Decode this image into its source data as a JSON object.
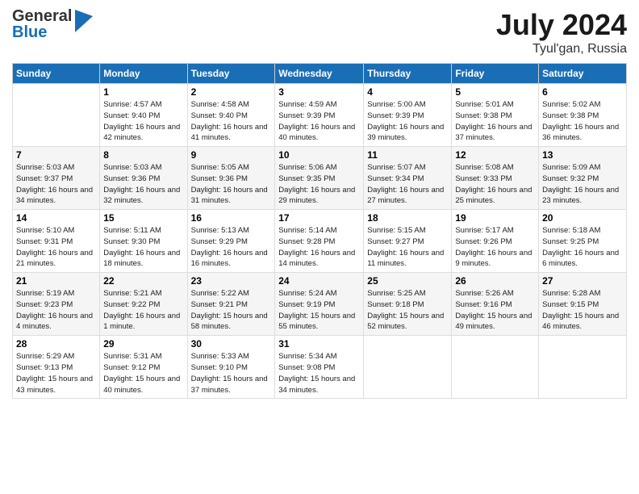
{
  "header": {
    "logo_general": "General",
    "logo_blue": "Blue",
    "month": "July 2024",
    "location": "Tyul'gan, Russia"
  },
  "days_of_week": [
    "Sunday",
    "Monday",
    "Tuesday",
    "Wednesday",
    "Thursday",
    "Friday",
    "Saturday"
  ],
  "weeks": [
    [
      {
        "day": "",
        "sunrise": "",
        "sunset": "",
        "daylight": ""
      },
      {
        "day": "1",
        "sunrise": "Sunrise: 4:57 AM",
        "sunset": "Sunset: 9:40 PM",
        "daylight": "Daylight: 16 hours and 42 minutes."
      },
      {
        "day": "2",
        "sunrise": "Sunrise: 4:58 AM",
        "sunset": "Sunset: 9:40 PM",
        "daylight": "Daylight: 16 hours and 41 minutes."
      },
      {
        "day": "3",
        "sunrise": "Sunrise: 4:59 AM",
        "sunset": "Sunset: 9:39 PM",
        "daylight": "Daylight: 16 hours and 40 minutes."
      },
      {
        "day": "4",
        "sunrise": "Sunrise: 5:00 AM",
        "sunset": "Sunset: 9:39 PM",
        "daylight": "Daylight: 16 hours and 39 minutes."
      },
      {
        "day": "5",
        "sunrise": "Sunrise: 5:01 AM",
        "sunset": "Sunset: 9:38 PM",
        "daylight": "Daylight: 16 hours and 37 minutes."
      },
      {
        "day": "6",
        "sunrise": "Sunrise: 5:02 AM",
        "sunset": "Sunset: 9:38 PM",
        "daylight": "Daylight: 16 hours and 36 minutes."
      }
    ],
    [
      {
        "day": "7",
        "sunrise": "Sunrise: 5:03 AM",
        "sunset": "Sunset: 9:37 PM",
        "daylight": "Daylight: 16 hours and 34 minutes."
      },
      {
        "day": "8",
        "sunrise": "Sunrise: 5:03 AM",
        "sunset": "Sunset: 9:36 PM",
        "daylight": "Daylight: 16 hours and 32 minutes."
      },
      {
        "day": "9",
        "sunrise": "Sunrise: 5:05 AM",
        "sunset": "Sunset: 9:36 PM",
        "daylight": "Daylight: 16 hours and 31 minutes."
      },
      {
        "day": "10",
        "sunrise": "Sunrise: 5:06 AM",
        "sunset": "Sunset: 9:35 PM",
        "daylight": "Daylight: 16 hours and 29 minutes."
      },
      {
        "day": "11",
        "sunrise": "Sunrise: 5:07 AM",
        "sunset": "Sunset: 9:34 PM",
        "daylight": "Daylight: 16 hours and 27 minutes."
      },
      {
        "day": "12",
        "sunrise": "Sunrise: 5:08 AM",
        "sunset": "Sunset: 9:33 PM",
        "daylight": "Daylight: 16 hours and 25 minutes."
      },
      {
        "day": "13",
        "sunrise": "Sunrise: 5:09 AM",
        "sunset": "Sunset: 9:32 PM",
        "daylight": "Daylight: 16 hours and 23 minutes."
      }
    ],
    [
      {
        "day": "14",
        "sunrise": "Sunrise: 5:10 AM",
        "sunset": "Sunset: 9:31 PM",
        "daylight": "Daylight: 16 hours and 21 minutes."
      },
      {
        "day": "15",
        "sunrise": "Sunrise: 5:11 AM",
        "sunset": "Sunset: 9:30 PM",
        "daylight": "Daylight: 16 hours and 18 minutes."
      },
      {
        "day": "16",
        "sunrise": "Sunrise: 5:13 AM",
        "sunset": "Sunset: 9:29 PM",
        "daylight": "Daylight: 16 hours and 16 minutes."
      },
      {
        "day": "17",
        "sunrise": "Sunrise: 5:14 AM",
        "sunset": "Sunset: 9:28 PM",
        "daylight": "Daylight: 16 hours and 14 minutes."
      },
      {
        "day": "18",
        "sunrise": "Sunrise: 5:15 AM",
        "sunset": "Sunset: 9:27 PM",
        "daylight": "Daylight: 16 hours and 11 minutes."
      },
      {
        "day": "19",
        "sunrise": "Sunrise: 5:17 AM",
        "sunset": "Sunset: 9:26 PM",
        "daylight": "Daylight: 16 hours and 9 minutes."
      },
      {
        "day": "20",
        "sunrise": "Sunrise: 5:18 AM",
        "sunset": "Sunset: 9:25 PM",
        "daylight": "Daylight: 16 hours and 6 minutes."
      }
    ],
    [
      {
        "day": "21",
        "sunrise": "Sunrise: 5:19 AM",
        "sunset": "Sunset: 9:23 PM",
        "daylight": "Daylight: 16 hours and 4 minutes."
      },
      {
        "day": "22",
        "sunrise": "Sunrise: 5:21 AM",
        "sunset": "Sunset: 9:22 PM",
        "daylight": "Daylight: 16 hours and 1 minute."
      },
      {
        "day": "23",
        "sunrise": "Sunrise: 5:22 AM",
        "sunset": "Sunset: 9:21 PM",
        "daylight": "Daylight: 15 hours and 58 minutes."
      },
      {
        "day": "24",
        "sunrise": "Sunrise: 5:24 AM",
        "sunset": "Sunset: 9:19 PM",
        "daylight": "Daylight: 15 hours and 55 minutes."
      },
      {
        "day": "25",
        "sunrise": "Sunrise: 5:25 AM",
        "sunset": "Sunset: 9:18 PM",
        "daylight": "Daylight: 15 hours and 52 minutes."
      },
      {
        "day": "26",
        "sunrise": "Sunrise: 5:26 AM",
        "sunset": "Sunset: 9:16 PM",
        "daylight": "Daylight: 15 hours and 49 minutes."
      },
      {
        "day": "27",
        "sunrise": "Sunrise: 5:28 AM",
        "sunset": "Sunset: 9:15 PM",
        "daylight": "Daylight: 15 hours and 46 minutes."
      }
    ],
    [
      {
        "day": "28",
        "sunrise": "Sunrise: 5:29 AM",
        "sunset": "Sunset: 9:13 PM",
        "daylight": "Daylight: 15 hours and 43 minutes."
      },
      {
        "day": "29",
        "sunrise": "Sunrise: 5:31 AM",
        "sunset": "Sunset: 9:12 PM",
        "daylight": "Daylight: 15 hours and 40 minutes."
      },
      {
        "day": "30",
        "sunrise": "Sunrise: 5:33 AM",
        "sunset": "Sunset: 9:10 PM",
        "daylight": "Daylight: 15 hours and 37 minutes."
      },
      {
        "day": "31",
        "sunrise": "Sunrise: 5:34 AM",
        "sunset": "Sunset: 9:08 PM",
        "daylight": "Daylight: 15 hours and 34 minutes."
      },
      {
        "day": "",
        "sunrise": "",
        "sunset": "",
        "daylight": ""
      },
      {
        "day": "",
        "sunrise": "",
        "sunset": "",
        "daylight": ""
      },
      {
        "day": "",
        "sunrise": "",
        "sunset": "",
        "daylight": ""
      }
    ]
  ]
}
